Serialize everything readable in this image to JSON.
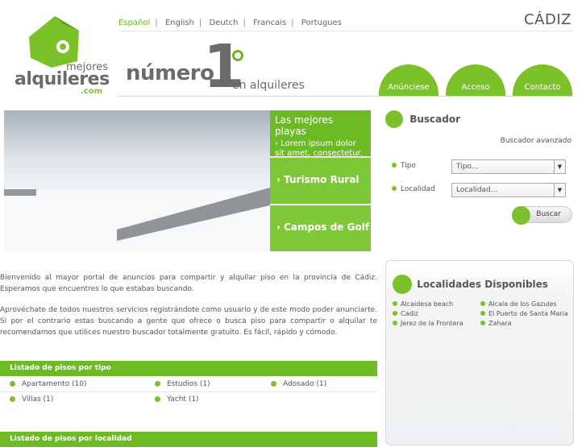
{
  "languages": [
    "Español",
    "English",
    "Deutch",
    "Francais",
    "Portugues"
  ],
  "active_language": "Español",
  "city": "CÁDIZ",
  "logo": {
    "line1": "mejores",
    "line2": "alquileres",
    "line3": ".com"
  },
  "slogan": {
    "word": "número",
    "number": "1",
    "rest": "en alquileres"
  },
  "topnav": [
    "Anúnciese",
    "Acceso",
    "Contacto"
  ],
  "promos": {
    "p1_title": "Las mejores playas",
    "p1_sub": "Lorem ipsum dolor sit amet, consectetur.",
    "p2": "Turismo Rural",
    "p3": "Campos de Golf"
  },
  "search": {
    "title": "Buscador",
    "advanced": "Buscador avanzado",
    "tipo_label": "Tipo",
    "tipo_value": "Tipo...",
    "localidad_label": "Localidad",
    "localidad_value": "Localidad...",
    "button": "Buscar"
  },
  "intro": {
    "p1": "Bienvenido al mayor portal de anuncios para compartir y alquilar piso en la provincia de Cádiz. Esperamos que encuentres lo que estabas buscando.",
    "p2": "Aprovéchate de todos nuestros servicios registrándote como usuario y de este modo poder anunciarte. Si por el contrario estas buscando a gente que ofrece o busca piso para compartir o alquilar te recomendamos que utilices nuestro buscador totalmente gratuito. Es fácil, rápido y cómodo."
  },
  "localidades": {
    "title": "Localidades Disponibles",
    "items": [
      "Alcaidesa beach",
      "Alcala de los Gazules",
      "Cadiz",
      "El Puerto de Santa Maria",
      "Jerez de la Frontera",
      "Zahara"
    ]
  },
  "listado_tipo": {
    "title": "Listado de pisos por tipo",
    "items": [
      "Apartamento (10)",
      "Estudios (1)",
      "Adosado (1)",
      "Villas (1)",
      "Yacht (1)"
    ]
  },
  "listado_localidad": {
    "title": "Listado de pisos por localidad"
  },
  "colors": {
    "accent": "#7bc12a",
    "text": "#555555"
  }
}
